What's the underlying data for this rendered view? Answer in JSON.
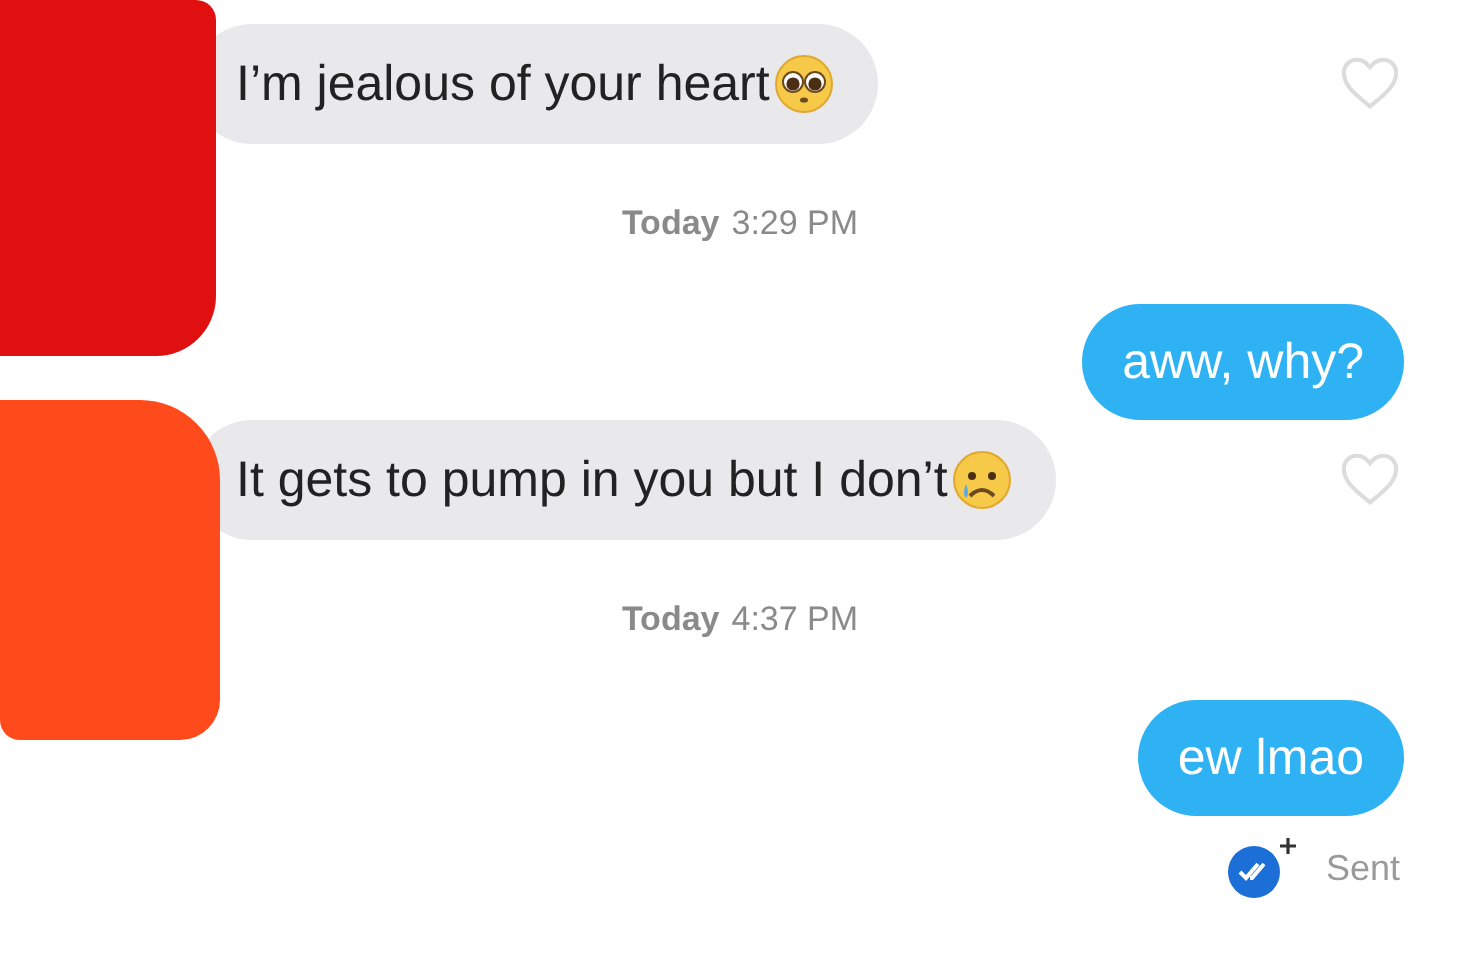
{
  "messages": [
    {
      "kind": "incoming",
      "text": "I’m jealous of your heart",
      "liked": false
    },
    {
      "kind": "time",
      "day": "Today",
      "time": "3:29 PM"
    },
    {
      "kind": "outgoing",
      "text": "aww, why?"
    },
    {
      "kind": "incoming",
      "text": "It gets to pump in you but I don’t",
      "liked": false
    },
    {
      "kind": "time",
      "day": "Today",
      "time": "4:37 PM"
    },
    {
      "kind": "outgoing",
      "text": "ew lmao"
    }
  ],
  "status": {
    "text": "Sent"
  }
}
